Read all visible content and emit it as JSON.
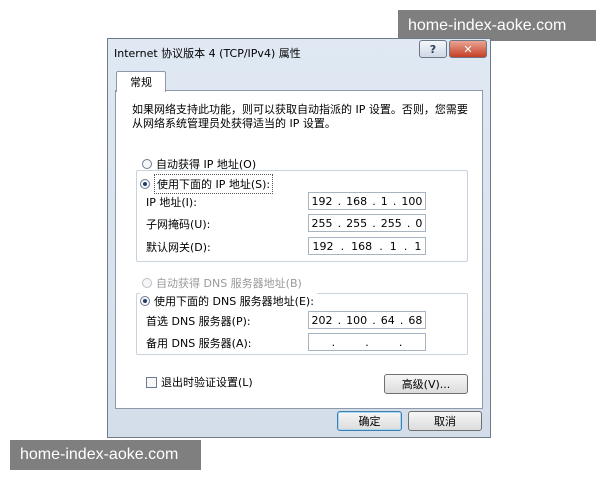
{
  "dialog": {
    "title": "Internet 协议版本 4 (TCP/IPv4) 属性",
    "help_label": "?",
    "close_label": "✕"
  },
  "tabs": [
    {
      "label": "常规"
    }
  ],
  "description": "如果网络支持此功能，则可以获取自动指派的 IP 设置。否则，您需要从网络系统管理员处获得适当的 IP 设置。",
  "ip": {
    "auto_label": "自动获得 IP 地址(O)",
    "manual_label": "使用下面的 IP 地址(S):",
    "auto_selected": false,
    "fields": [
      {
        "label": "IP 地址(I):",
        "octets": [
          "192",
          "168",
          "1",
          "100"
        ]
      },
      {
        "label": "子网掩码(U):",
        "octets": [
          "255",
          "255",
          "255",
          "0"
        ]
      },
      {
        "label": "默认网关(D):",
        "octets": [
          "192",
          "168",
          "1",
          "1"
        ]
      }
    ]
  },
  "dns": {
    "auto_label": "自动获得 DNS 服务器地址(B)",
    "manual_label": "使用下面的 DNS 服务器地址(E):",
    "auto_enabled": false,
    "fields": [
      {
        "label": "首选 DNS 服务器(P):",
        "octets": [
          "202",
          "100",
          "64",
          "68"
        ]
      },
      {
        "label": "备用 DNS 服务器(A):",
        "octets": [
          "",
          "",
          "",
          ""
        ]
      }
    ]
  },
  "validate": {
    "label": "退出时验证设置(L)",
    "checked": false
  },
  "buttons": {
    "advanced": "高级(V)...",
    "ok": "确定",
    "cancel": "取消"
  },
  "watermark": {
    "top": "home-index-aoke.com",
    "bottom": "home-index-aoke.com"
  }
}
